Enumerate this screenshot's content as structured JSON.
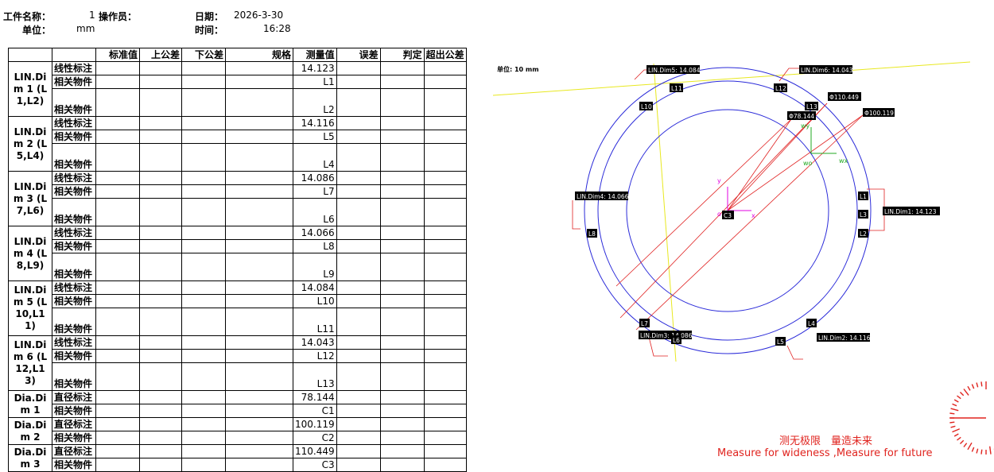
{
  "header": {
    "part_name_label": "工件名称：",
    "part_name_value": "1",
    "operator_label": "操作员：",
    "operator_value": "",
    "date_label": "日期：",
    "date_value": "2026-3-30",
    "unit_label": "单位：",
    "unit_value": "mm",
    "time_label": "时间：",
    "time_value": "16:28"
  },
  "table": {
    "columns": [
      "",
      "",
      "标准值",
      "上公差",
      "下公差",
      "规格",
      "测量值",
      "误差",
      "判定",
      "超出公差"
    ],
    "groups": [
      {
        "name": "LIN.Dim 1 (L1,L2)",
        "rows": [
          [
            "线性标注",
            "14.123"
          ],
          [
            "相关物件",
            "L1"
          ],
          [
            "相关物件",
            "L2"
          ]
        ]
      },
      {
        "name": "LIN.Dim 2 (L5,L4)",
        "rows": [
          [
            "线性标注",
            "14.116"
          ],
          [
            "相关物件",
            "L5"
          ],
          [
            "相关物件",
            "L4"
          ]
        ]
      },
      {
        "name": "LIN.Dim 3 (L7,L6)",
        "rows": [
          [
            "线性标注",
            "14.086"
          ],
          [
            "相关物件",
            "L7"
          ],
          [
            "相关物件",
            "L6"
          ]
        ]
      },
      {
        "name": "LIN.Dim 4 (L8,L9)",
        "rows": [
          [
            "线性标注",
            "14.066"
          ],
          [
            "相关物件",
            "L8"
          ],
          [
            "相关物件",
            "L9"
          ]
        ]
      },
      {
        "name": "LIN.Dim 5 (L10,L11)",
        "rows": [
          [
            "线性标注",
            "14.084"
          ],
          [
            "相关物件",
            "L10"
          ],
          [
            "相关物件",
            "L11"
          ]
        ]
      },
      {
        "name": "LIN.Dim 6 (L12,L13)",
        "rows": [
          [
            "线性标注",
            "14.043"
          ],
          [
            "相关物件",
            "L12"
          ],
          [
            "相关物件",
            "L13"
          ]
        ]
      },
      {
        "name": "Dia.Dim 1",
        "rows": [
          [
            "直径标注",
            "78.144"
          ],
          [
            "相关物件",
            "C1"
          ]
        ]
      },
      {
        "name": "Dia.Dim 2",
        "rows": [
          [
            "直径标注",
            "100.119"
          ],
          [
            "相关物件",
            "C2"
          ]
        ]
      },
      {
        "name": "Dia.Dim 3",
        "rows": [
          [
            "直径标注",
            "110.449"
          ],
          [
            "相关物件",
            "C3"
          ]
        ]
      }
    ]
  },
  "drawing": {
    "unit_note": "单位: 10 mm",
    "dim_labels": {
      "d1": "LIN.Dim1: 14.123",
      "d2": "LIN.Dim2: 14.116",
      "d3": "LIN.Dim3: 14.086",
      "d4": "LIN.Dim4: 14.066",
      "d5": "LIN.Dim5: 14.084",
      "d6": "LIN.Dim6: 14.043",
      "phi1": "Φ110.449",
      "phi2": "Φ78.144",
      "phi3": "Φ100.119"
    },
    "tags": [
      "L1",
      "L2",
      "L3",
      "L4",
      "L5",
      "L6",
      "L7",
      "L8",
      "L10",
      "L11",
      "L12",
      "L13",
      "C3"
    ],
    "axes": {
      "x": "x",
      "y": "y",
      "wx": "wx",
      "wy": "wy",
      "wo": "wo",
      "o": "o"
    }
  },
  "slogan": {
    "cn": "测无极限　量造未来",
    "en": "Measure for wideness ,Measure for future"
  },
  "colors": {
    "circle": "#2b2bd9",
    "dimension": "#e02020",
    "axis_pink": "#e000e0",
    "axis_green": "#22aa22",
    "guide": "#e8e820",
    "brand": "#e0241f"
  }
}
